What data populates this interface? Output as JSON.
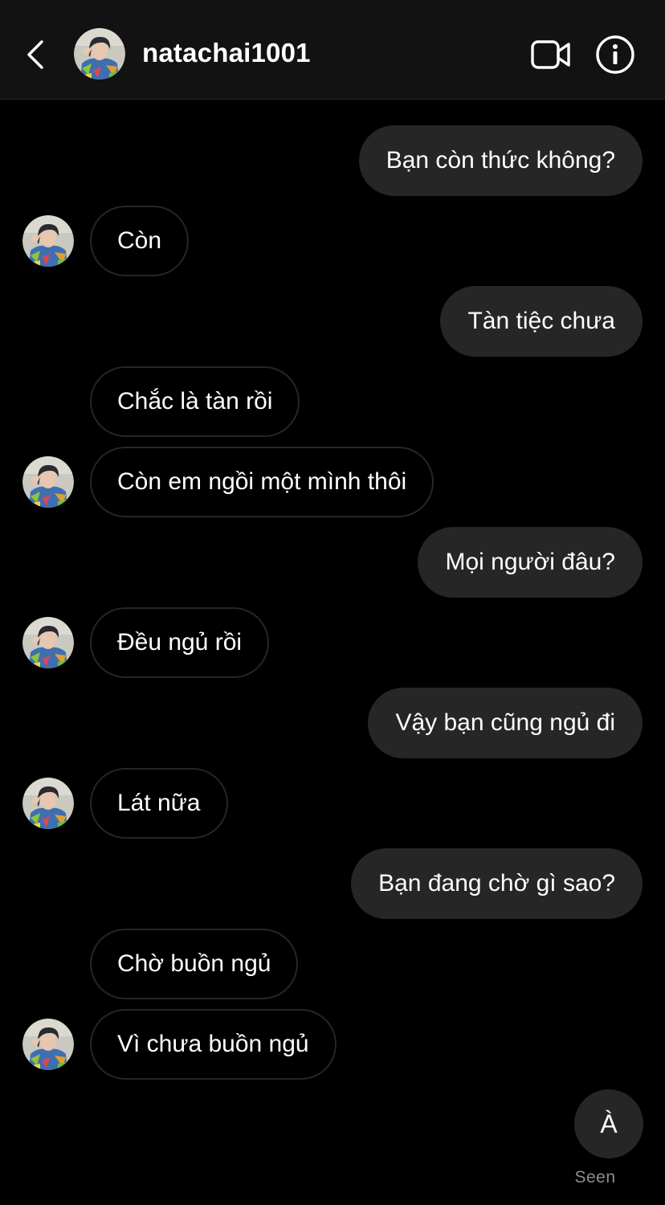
{
  "header": {
    "username": "natachai1001",
    "back_icon": "chevron-left-icon",
    "video_icon": "video-camera-icon",
    "info_icon": "info-icon"
  },
  "colors": {
    "background": "#000000",
    "header_bg": "#121212",
    "outgoing_bubble": "#262626",
    "incoming_border": "#262626",
    "muted_text": "#8e8e8e"
  },
  "messages": [
    {
      "direction": "out",
      "text": "Bạn còn thức không?",
      "avatar": false
    },
    {
      "direction": "in",
      "text": "Còn",
      "avatar": true
    },
    {
      "direction": "out",
      "text": "Tàn tiệc chưa",
      "avatar": false
    },
    {
      "direction": "in",
      "text": "Chắc là tàn rồi",
      "avatar": false
    },
    {
      "direction": "in",
      "text": "Còn em ngồi một mình thôi",
      "avatar": true
    },
    {
      "direction": "out",
      "text": "Mọi người đâu?",
      "avatar": false
    },
    {
      "direction": "in",
      "text": "Đều ngủ rồi",
      "avatar": true
    },
    {
      "direction": "out",
      "text": "Vậy bạn cũng ngủ đi",
      "avatar": false
    },
    {
      "direction": "in",
      "text": "Lát nữa",
      "avatar": true
    },
    {
      "direction": "out",
      "text": "Bạn đang chờ gì sao?",
      "avatar": false
    },
    {
      "direction": "in",
      "text": "Chờ buồn ngủ",
      "avatar": false
    },
    {
      "direction": "in",
      "text": "Vì chưa buồn ngủ",
      "avatar": true
    }
  ],
  "last_message": {
    "text": "À",
    "status": "Seen"
  }
}
